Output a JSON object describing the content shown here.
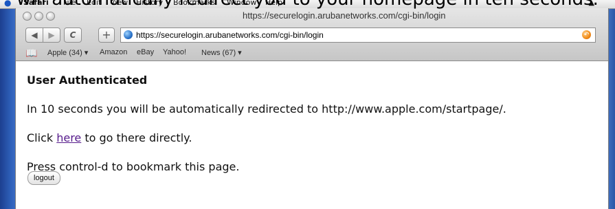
{
  "caption": "will automatically redirect you to your homepage in ten seconds.",
  "menubar": {
    "items": [
      "Safari",
      "File",
      "Edit",
      "View",
      "History",
      "Bookmarks",
      "Window",
      "Help"
    ]
  },
  "window": {
    "title": "https://securelogin.arubanetworks.com/cgi-bin/login"
  },
  "toolbar": {
    "back_label": "◀",
    "forward_label": "▶",
    "reload_label": "C",
    "add_bookmark_label": "+",
    "url": "https://securelogin.arubanetworks.com/cgi-bin/login"
  },
  "bookmarks_bar": {
    "items": [
      "Apple (34) ▾",
      "Amazon",
      "eBay",
      "Yahoo!",
      "News (67) ▾"
    ]
  },
  "page": {
    "heading": "User Authenticated",
    "redirect_text": "In 10 seconds you will be automatically redirected to http://www.apple.com/startpage/.",
    "click_prefix": "Click ",
    "here_link": "here",
    "click_suffix": " to go there directly.",
    "bookmark_hint": "Press control-d to bookmark this page.",
    "logout_label": "logout"
  }
}
